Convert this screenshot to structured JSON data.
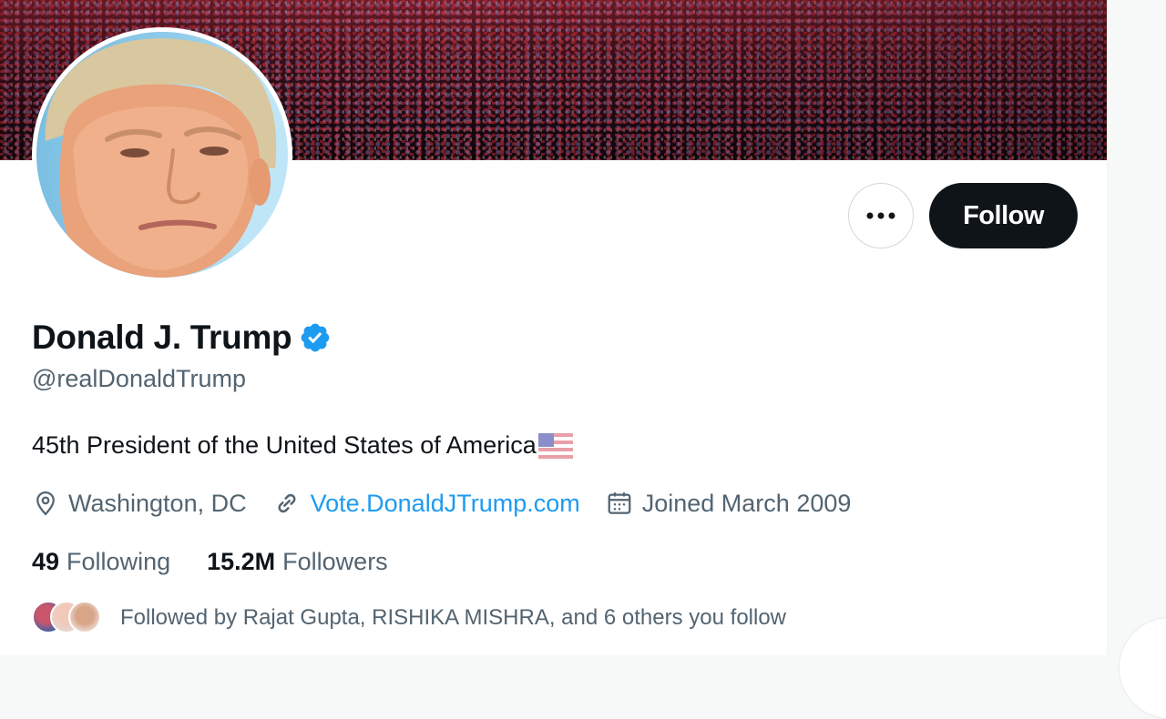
{
  "profile": {
    "display_name": "Donald J. Trump",
    "verified": true,
    "handle": "@realDonaldTrump",
    "bio": "45th President of the United States of America",
    "bio_emoji": "us-flag-icon",
    "location": "Washington, DC",
    "website": "Vote.DonaldJTrump.com",
    "joined": "Joined March 2009"
  },
  "actions": {
    "more_label": "More",
    "follow_label": "Follow"
  },
  "stats": {
    "following_count": "49",
    "following_label": "Following",
    "followers_count": "15.2M",
    "followers_label": "Followers"
  },
  "followed_by": {
    "text": "Followed by Rajat Gupta, RISHIKA MISHRA, and 6 others you follow"
  },
  "colors": {
    "accent": "#1d9bf0",
    "primary_text": "#0f1419",
    "secondary_text": "#536471",
    "follow_button_bg": "#0f1419",
    "verified_badge": "#1d9bf0"
  }
}
